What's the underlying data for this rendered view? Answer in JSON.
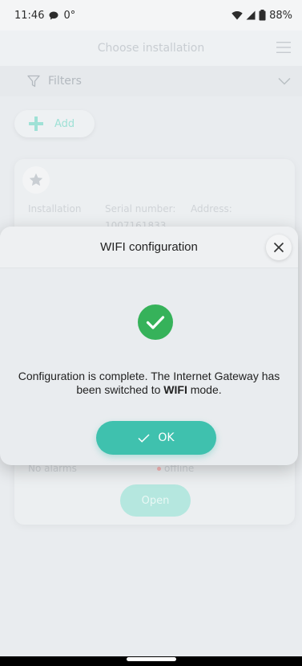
{
  "status_bar": {
    "time": "11:46",
    "temperature": "0°",
    "battery": "88%"
  },
  "header": {
    "title": "Choose installation"
  },
  "filters": {
    "label": "Filters"
  },
  "add": {
    "label": "Add"
  },
  "card": {
    "installation_label": "Installation",
    "serial_label": "Serial number:",
    "address_label": "Address:",
    "serial_value": "1007161833",
    "alarms": "No alarms",
    "status": "offline",
    "open_label": "Open"
  },
  "dialog": {
    "title": "WIFI configuration",
    "message_before": "Configuration is complete. The Internet Gateway has been switched to ",
    "message_bold": "WIFI",
    "message_after": " mode.",
    "ok_label": "OK"
  },
  "colors": {
    "accent": "#3fc1ae",
    "success": "#36b25a"
  },
  "icons": {
    "status_bar": [
      "chat-bubble-icon",
      "wifi-icon",
      "signal-icon",
      "battery-icon"
    ],
    "header": "menu-icon",
    "filters": [
      "filter-icon",
      "chevron-down-icon"
    ],
    "add": "plus-icon",
    "card": "star-icon",
    "dialog": [
      "close-icon",
      "success-check-icon",
      "check-icon"
    ]
  }
}
